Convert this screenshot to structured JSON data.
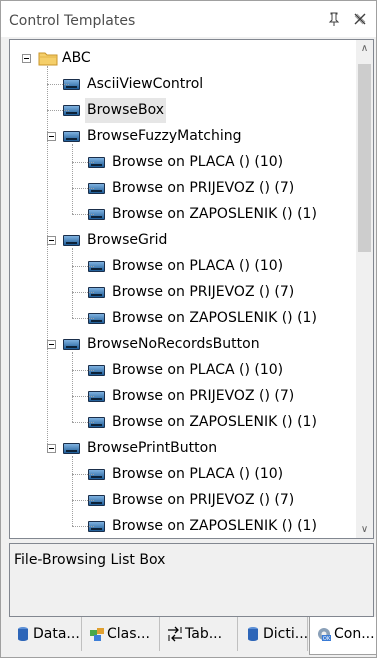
{
  "panel": {
    "title": "Control Templates",
    "pin_icon": "pin-icon",
    "close_icon": "close-icon"
  },
  "tree": {
    "root_label": "ABC",
    "items": [
      {
        "label": "AsciiViewControl"
      },
      {
        "label": "BrowseBox",
        "selected": true
      },
      {
        "label": "BrowseFuzzyMatching",
        "children": [
          "Browse on PLACA () (10)",
          "Browse on PRIJEVOZ () (7)",
          "Browse on ZAPOSLENIK () (1)"
        ]
      },
      {
        "label": "BrowseGrid",
        "children": [
          "Browse on PLACA () (10)",
          "Browse on PRIJEVOZ () (7)",
          "Browse on ZAPOSLENIK () (1)"
        ]
      },
      {
        "label": "BrowseNoRecordsButton",
        "children": [
          "Browse on PLACA () (10)",
          "Browse on PRIJEVOZ () (7)",
          "Browse on ZAPOSLENIK () (1)"
        ]
      },
      {
        "label": "BrowsePrintButton",
        "children": [
          "Browse on PLACA () (10)",
          "Browse on PRIJEVOZ () (7)",
          "Browse on ZAPOSLENIK () (1)"
        ]
      }
    ]
  },
  "description": "File-Browsing List Box",
  "tabs": [
    {
      "label": "Data...",
      "icon": "database-icon"
    },
    {
      "label": "Clas...",
      "icon": "classes-icon"
    },
    {
      "label": "Tab...",
      "icon": "tab-order-icon"
    },
    {
      "label": "Dicti...",
      "icon": "dictionary-icon"
    },
    {
      "label": "Con...",
      "icon": "control-templates-icon",
      "active": true
    }
  ]
}
